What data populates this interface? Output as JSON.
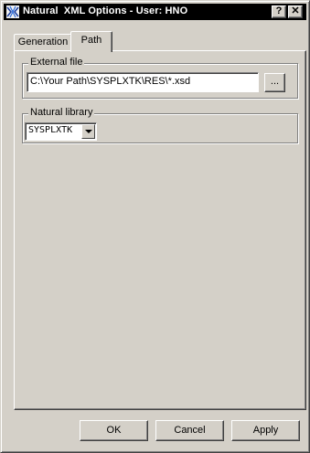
{
  "window": {
    "title": "Natural  XML Options - User: HNO",
    "help_button": "?",
    "close_button": "✕"
  },
  "tabs": [
    {
      "label": "Generation",
      "selected": false
    },
    {
      "label": "Path",
      "selected": true
    }
  ],
  "external_file": {
    "group_label": "External file",
    "value": "C:\\Your Path\\SYSPLXTK\\RES\\*.xsd",
    "browse_label": "..."
  },
  "natural_library": {
    "group_label": "Natural library",
    "selected": "SYSPLXTK"
  },
  "buttons": {
    "ok": "OK",
    "cancel": "Cancel",
    "apply": "Apply"
  },
  "icons": {
    "title": "natural-xml-app-icon",
    "browse": "ellipsis-browse",
    "dropdown": "chevron-down-icon"
  }
}
